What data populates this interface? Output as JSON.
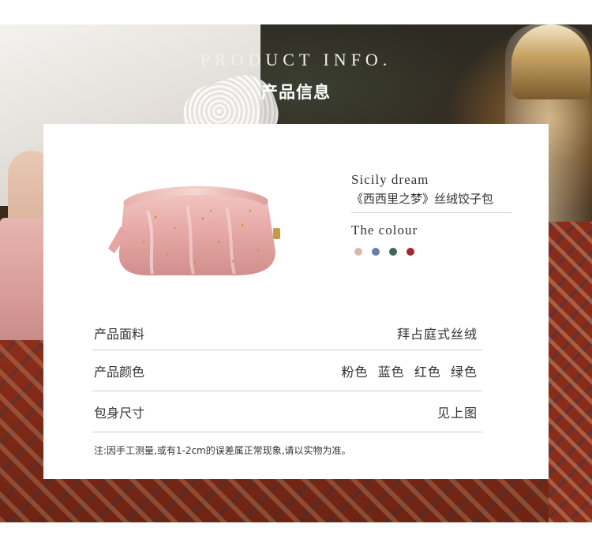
{
  "header": {
    "title_en": "PRODUCT INFO.",
    "title_cn": "产品信息"
  },
  "product": {
    "name_en": "Sicily dream",
    "name_cn": "《西西里之梦》丝绒饺子包",
    "image_icon": "pink-velvet-pouch-illustration"
  },
  "colour": {
    "title": "The colour",
    "swatches": [
      {
        "name": "粉色",
        "color": "#d9b8b6"
      },
      {
        "name": "蓝色",
        "color": "#6b7fa6"
      },
      {
        "name": "绿色",
        "color": "#3e6a55"
      },
      {
        "name": "红色",
        "color": "#a8242e"
      }
    ]
  },
  "specs": [
    {
      "label": "产品面料",
      "value": "拜占庭式丝绒"
    },
    {
      "label": "产品颜色",
      "value": "粉色  蓝色  红色  绿色"
    },
    {
      "label": "包身尺寸",
      "value": "见上图"
    }
  ],
  "note": "注:因手工测量,或有1-2cm的误差属正常现象,请以实物为准。"
}
